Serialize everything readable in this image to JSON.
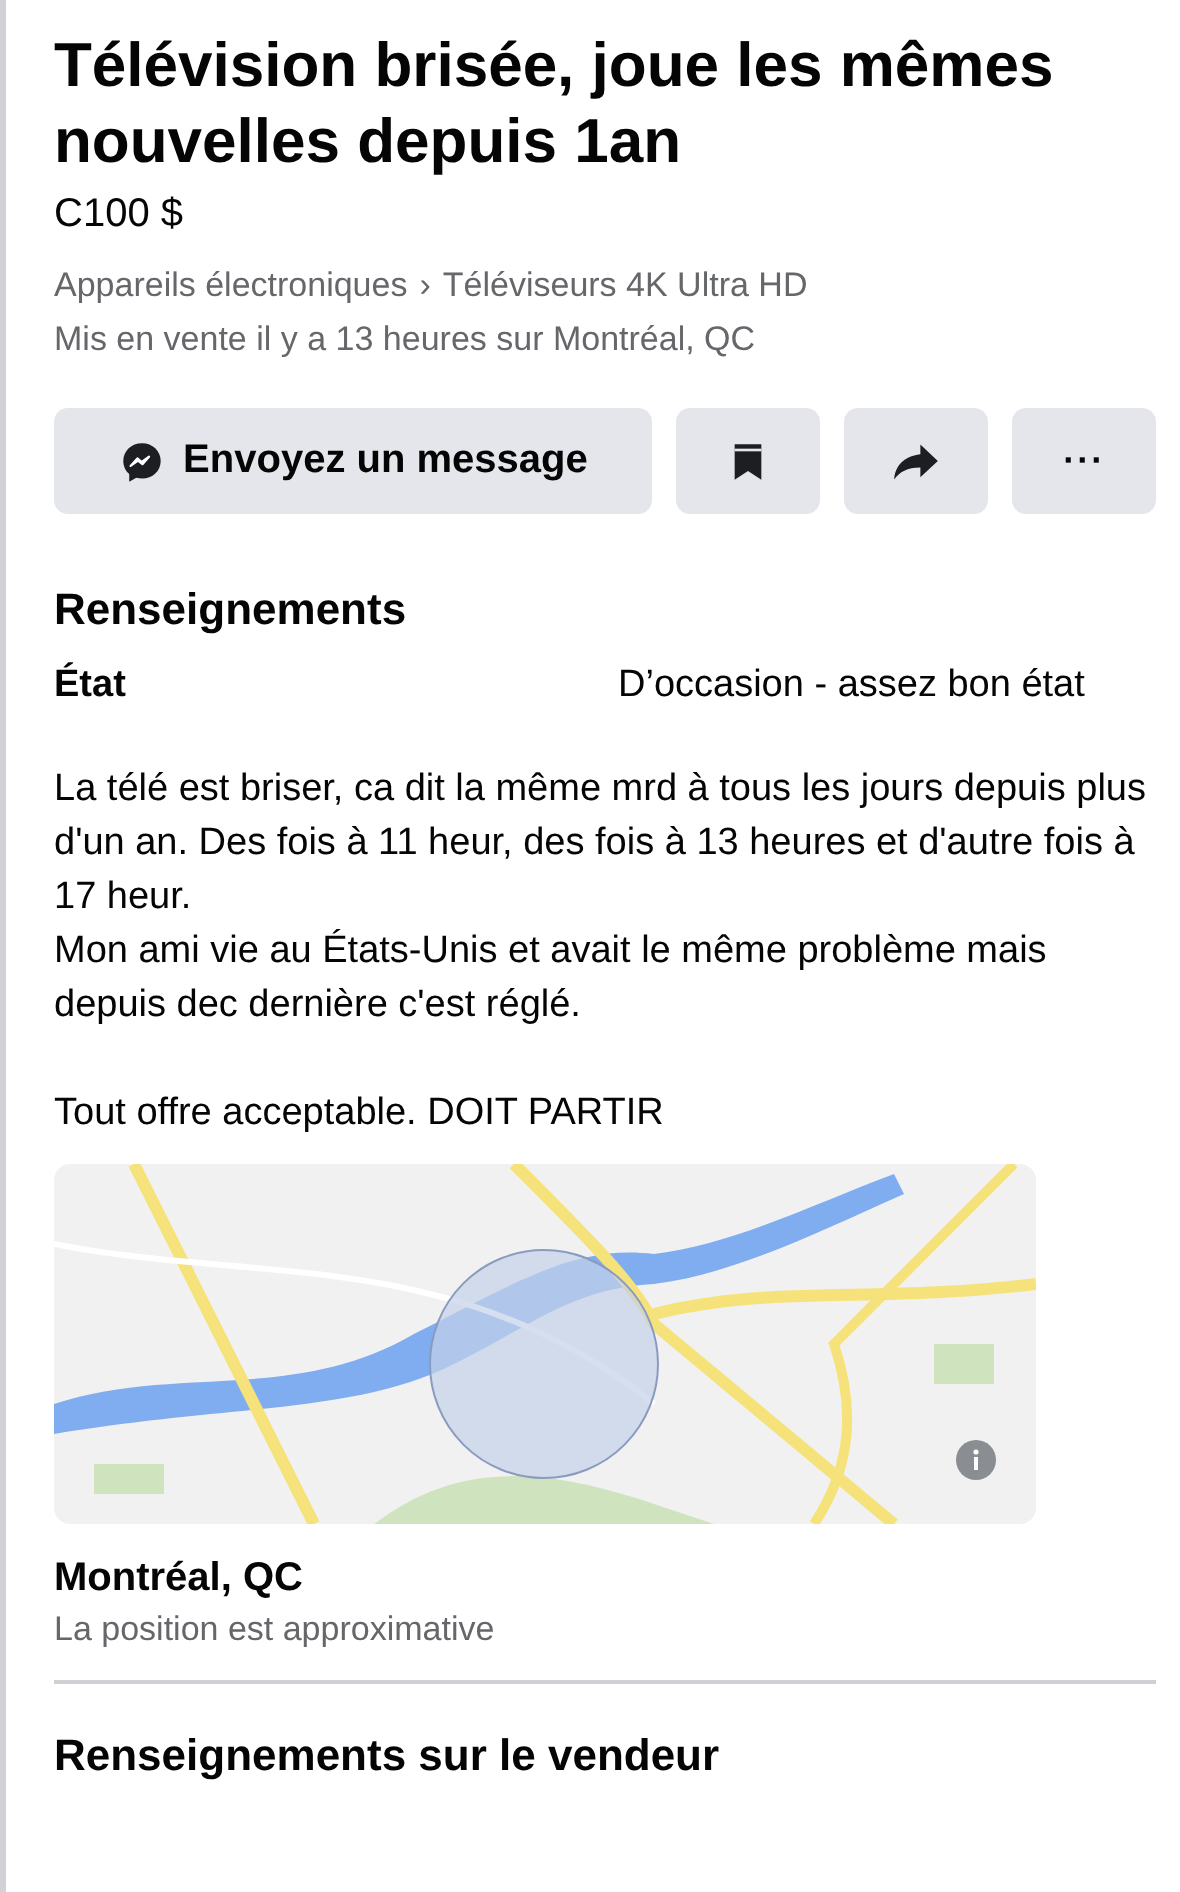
{
  "listing": {
    "title": "Télévision brisée, joue les mêmes nouvelles depuis 1an",
    "price": "C100 $",
    "breadcrumb": [
      "Appareils électroniques",
      "Téléviseurs 4K Ultra HD"
    ],
    "breadcrumb_separator": "›",
    "posted": "Mis en vente il y a 13 heures sur Montréal, QC"
  },
  "actions": [
    {
      "kind": "message",
      "label": "Envoyez un message"
    },
    {
      "kind": "save"
    },
    {
      "kind": "share"
    },
    {
      "kind": "more",
      "label": "···"
    }
  ],
  "details": {
    "heading": "Renseignements",
    "fields": [
      {
        "label": "État",
        "value": "D’occasion - assez bon état"
      }
    ],
    "description": "La télé est briser, ca dit la même mrd à tous les jours depuis plus d'un an. Des fois à 11 heur, des fois à 13 heures et d'autre fois à 17 heur.\nMon ami vie au États-Unis et avait le même problème mais depuis dec dernière c'est réglé.\n\nTout offre acceptable. DOIT PARTIR"
  },
  "map": {
    "kind": "picture",
    "location": "Montréal, QC",
    "note": "La position est approximative"
  },
  "seller": {
    "heading": "Renseignements sur le vendeur"
  }
}
